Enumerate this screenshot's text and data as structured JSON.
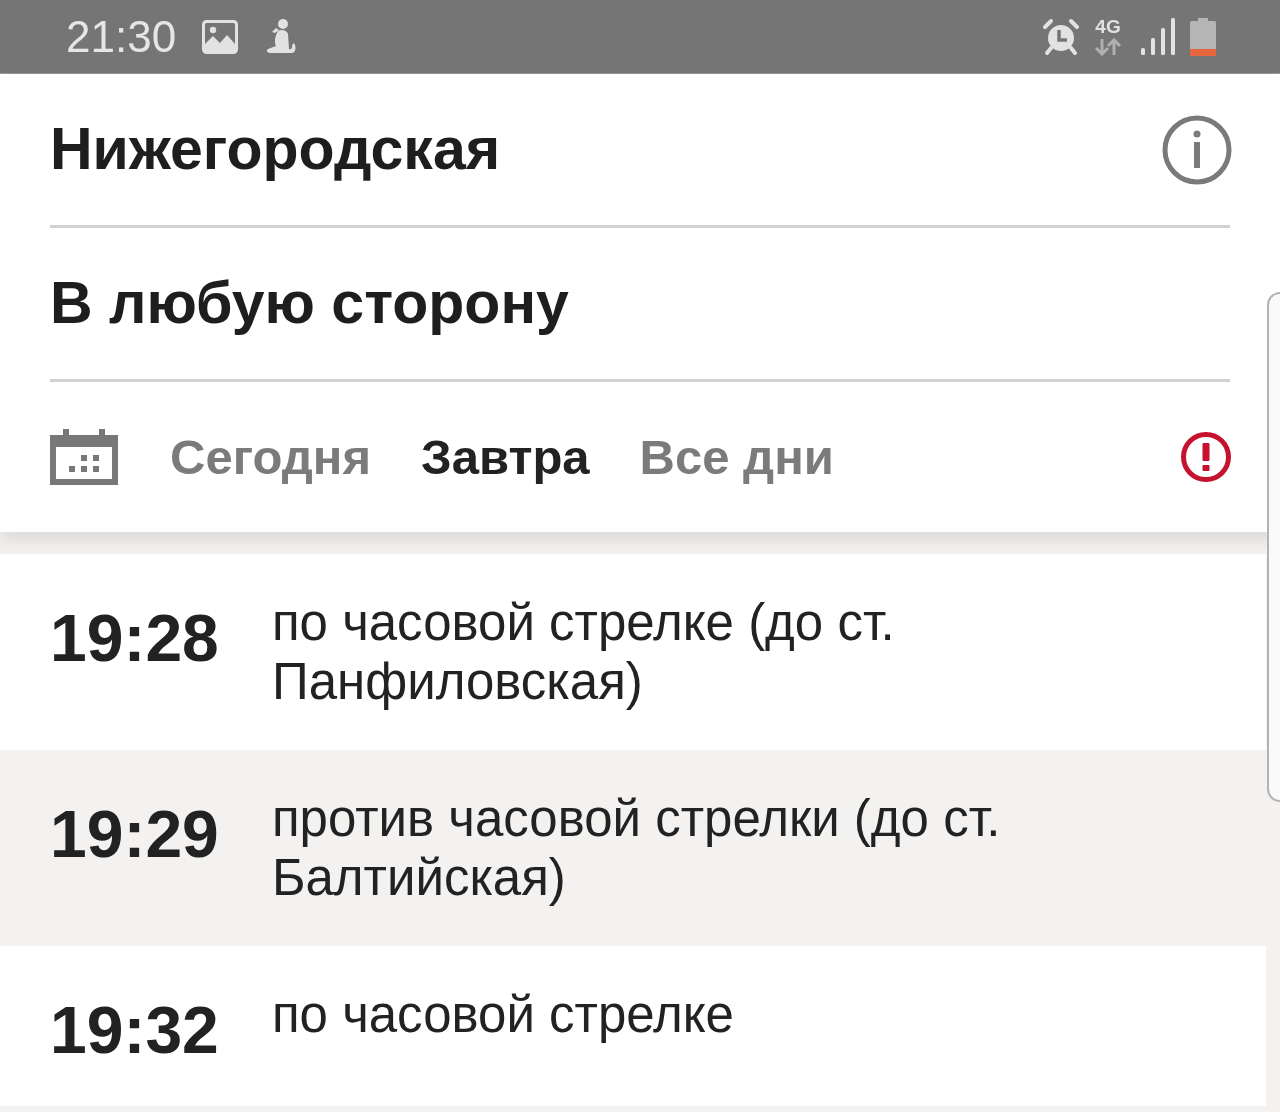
{
  "status_bar": {
    "time": "21:30",
    "network": "4G"
  },
  "station": {
    "title": "Нижегородская"
  },
  "direction": {
    "label": "В любую сторону"
  },
  "day_tabs": [
    {
      "label": "Сегодня",
      "selected": false
    },
    {
      "label": "Завтра",
      "selected": true
    },
    {
      "label": "Все дни",
      "selected": false
    }
  ],
  "departures": [
    {
      "time": "19:28",
      "direction": "по часовой стрелке (до ст. Панфиловская)"
    },
    {
      "time": "19:29",
      "direction": "против часовой стрелки (до ст. Балтийская)"
    },
    {
      "time": "19:32",
      "direction": "по часовой стрелке"
    }
  ]
}
